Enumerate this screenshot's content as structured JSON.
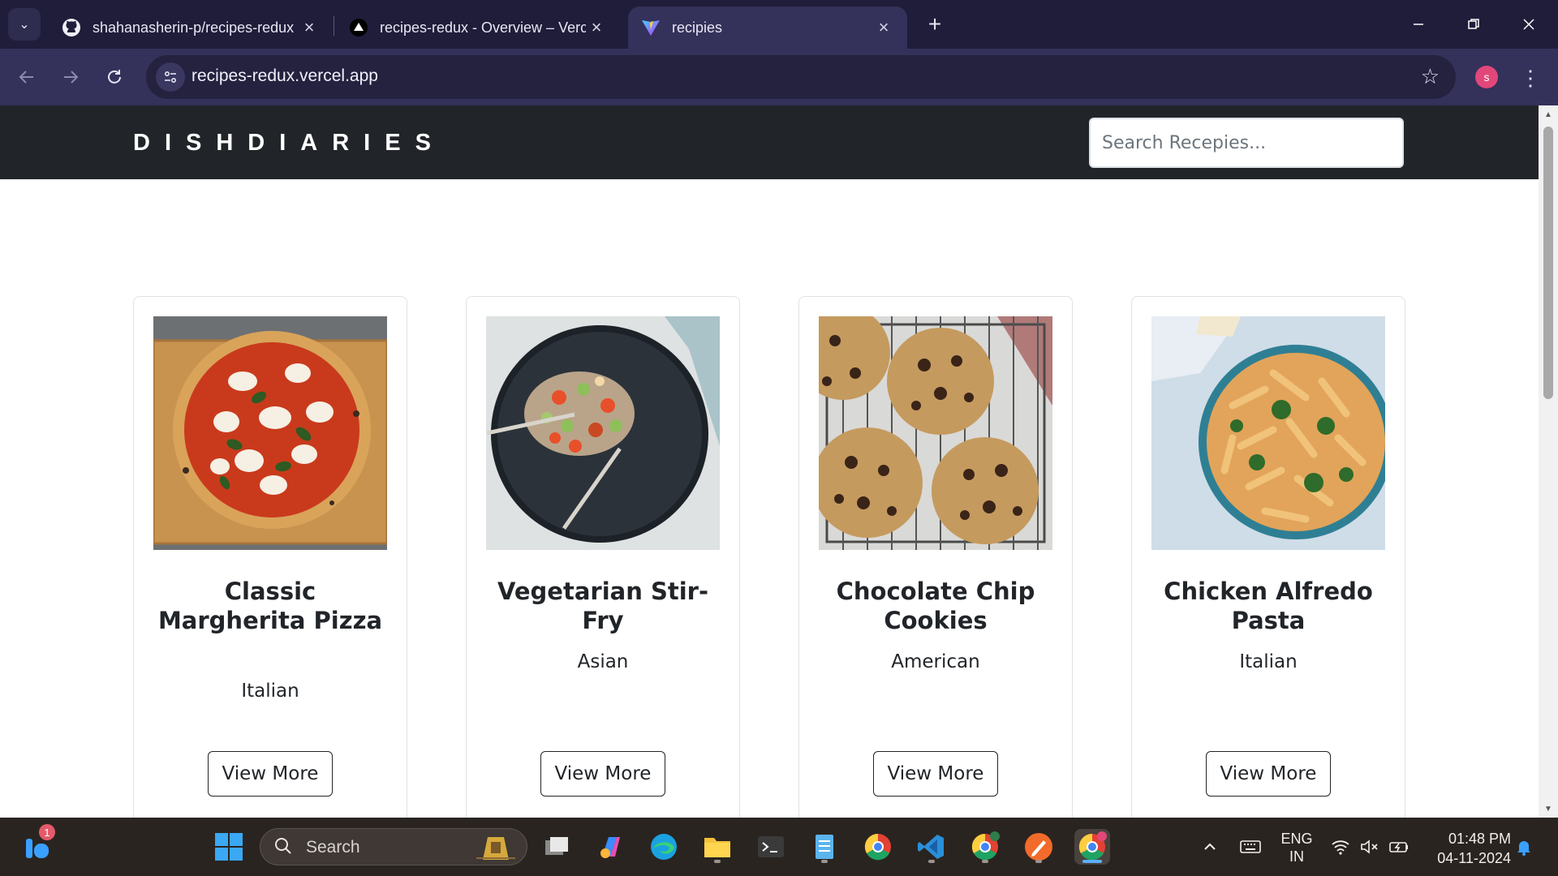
{
  "browser": {
    "tabs": [
      {
        "title": "shahanasherin-p/recipes-redux",
        "icon": "github-icon",
        "active": false
      },
      {
        "title": "recipes-redux - Overview – Vercel",
        "icon": "vercel-icon",
        "active": false
      },
      {
        "title": "recipies",
        "icon": "vite-icon",
        "active": true
      }
    ],
    "url": "recipes-redux.vercel.app",
    "profile_initial": "s"
  },
  "site": {
    "brand": "DISHDIARIES",
    "search_placeholder": "Search Recepies..."
  },
  "recipes": [
    {
      "name": "Classic Margherita Pizza",
      "cuisine": "Italian",
      "button": "View More",
      "image": "margherita-pizza"
    },
    {
      "name": "Vegetarian Stir-Fry",
      "cuisine": "Asian",
      "button": "View More",
      "image": "stir-fry-bowl"
    },
    {
      "name": "Chocolate Chip Cookies",
      "cuisine": "American",
      "button": "View More",
      "image": "chocolate-chip-cookies"
    },
    {
      "name": "Chicken Alfredo Pasta",
      "cuisine": "Italian",
      "button": "View More",
      "image": "penne-pasta-bowl"
    }
  ],
  "taskbar": {
    "search_label": "Search",
    "notification_badge": "1",
    "language": "ENG",
    "region": "IN",
    "time": "01:48 PM",
    "date": "04-11-2024"
  },
  "colors": {
    "browser_frame": "#1f1d3a",
    "toolbar": "#34315a",
    "site_header": "#212529",
    "taskbar": "#2a2420"
  }
}
